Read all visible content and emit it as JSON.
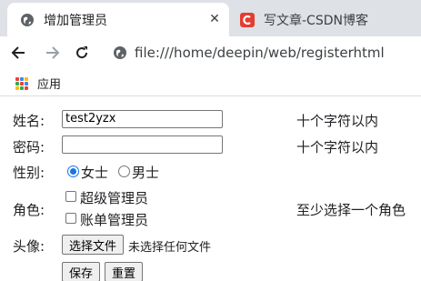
{
  "browser": {
    "tabs": [
      {
        "title": "增加管理员",
        "active": true,
        "close": "✕"
      },
      {
        "title": "写文章-CSDN博客",
        "active": false
      }
    ],
    "url": "file:///home/deepin/web/registerhtml",
    "bookmarks": {
      "apps_label": "应用"
    },
    "colors": {
      "tabstrip": "#dee1e6",
      "csdn_red": "#e33e33"
    }
  },
  "form": {
    "name": {
      "label": "姓名:",
      "value": "test2yzx",
      "hint": "十个字符以内"
    },
    "password": {
      "label": "密码:",
      "value": "",
      "hint": "十个字符以内"
    },
    "gender": {
      "label": "性别:",
      "options": [
        "女士",
        "男士"
      ],
      "selected": "女士"
    },
    "role": {
      "label": "角色:",
      "options": [
        "超级管理员",
        "账单管理员"
      ],
      "hint": "至少选择一个角色"
    },
    "avatar": {
      "label": "头像:",
      "button": "选择文件",
      "status": "未选择任何文件"
    },
    "actions": {
      "save": "保存",
      "reset": "重置"
    }
  }
}
